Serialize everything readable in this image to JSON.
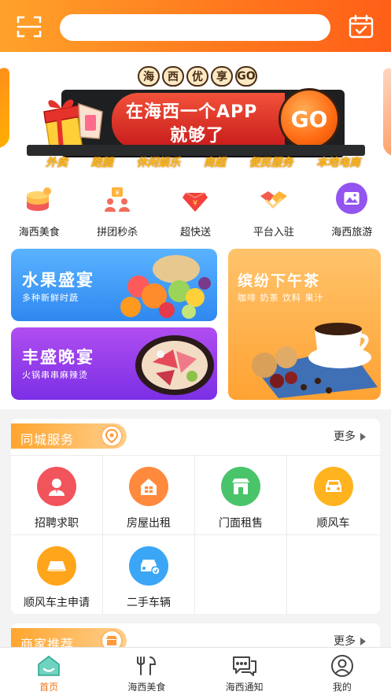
{
  "header": {
    "search_placeholder": "",
    "scan_icon": "scan-icon",
    "calendar_icon": "calendar-check-icon",
    "accent": "#ff7a1e"
  },
  "banner": {
    "slogan_chips": [
      "海",
      "西",
      "优",
      "享",
      "GO"
    ],
    "line1": "在海西一个APP",
    "line2": "就够了",
    "go_label": "GO",
    "tags": [
      "外卖",
      "跑腿",
      "休闲娱乐",
      "商超",
      "便民服务",
      "本地电商"
    ]
  },
  "categories": [
    {
      "label": "海西美食",
      "icon": "food-stack-icon"
    },
    {
      "label": "拼团秒杀",
      "icon": "group-buy-icon"
    },
    {
      "label": "超快送",
      "icon": "diamond-coin-icon"
    },
    {
      "label": "平台入驻",
      "icon": "handshake-icon"
    },
    {
      "label": "海西旅游",
      "icon": "landscape-icon"
    }
  ],
  "promos": {
    "fruit": {
      "title": "水果盛宴",
      "subtitle": "多种新鲜时蔬"
    },
    "dinner": {
      "title": "丰盛晚宴",
      "subtitle": "火锅串串麻辣烫"
    },
    "tea": {
      "title": "缤纷下午茶",
      "subtitle": "咖啡 奶茶 饮料 果汁"
    }
  },
  "city_service": {
    "title": "同城服务",
    "more": "更多",
    "items": [
      {
        "label": "招聘求职",
        "icon": "recruit-icon",
        "color": "#f2545b"
      },
      {
        "label": "房屋出租",
        "icon": "house-rent-icon",
        "color": "#ff8a3d"
      },
      {
        "label": "门面租售",
        "icon": "storefront-icon",
        "color": "#4ac46a"
      },
      {
        "label": "顺风车",
        "icon": "car-icon",
        "color": "#ffb31f"
      },
      {
        "label": "顺风车主申请",
        "icon": "driver-apply-icon",
        "color": "#ffa51c"
      },
      {
        "label": "二手车辆",
        "icon": "used-car-icon",
        "color": "#3aa6f5"
      }
    ]
  },
  "merchant_rec": {
    "title": "商家推荐",
    "more": "更多"
  },
  "tabs": [
    {
      "label": "首页",
      "icon": "home-icon",
      "active": true
    },
    {
      "label": "海西美食",
      "icon": "fork-knife-icon",
      "active": false
    },
    {
      "label": "海西通知",
      "icon": "chat-bubble-icon",
      "active": false
    },
    {
      "label": "我的",
      "icon": "user-profile-icon",
      "active": false
    }
  ]
}
